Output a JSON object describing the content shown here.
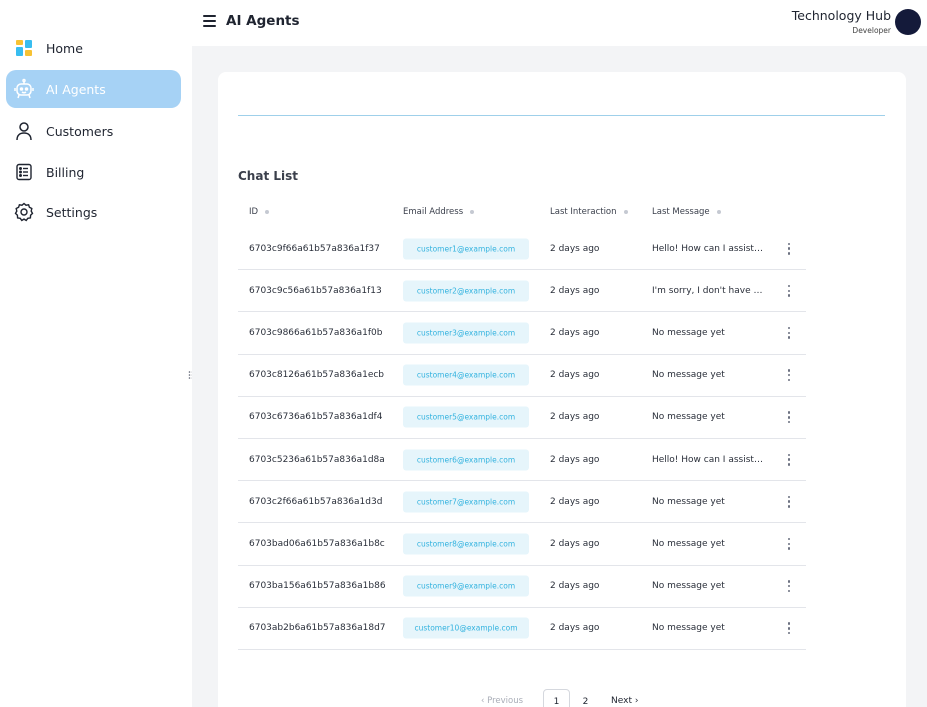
{
  "header": {
    "title": "AI Agents",
    "org_name": "Technology Hub",
    "org_role": "Developer"
  },
  "sidebar": {
    "items": [
      {
        "label": "Home",
        "icon": "home-icon"
      },
      {
        "label": "AI Agents",
        "icon": "robot-icon",
        "active": true
      },
      {
        "label": "Customers",
        "icon": "user-icon"
      },
      {
        "label": "Billing",
        "icon": "billing-icon"
      },
      {
        "label": "Settings",
        "icon": "gear-icon"
      }
    ]
  },
  "main": {
    "section_title": "Chat List",
    "columns": [
      "ID",
      "Email Address",
      "Last Interaction",
      "Last Message"
    ],
    "rows": [
      {
        "id": "6703c9f66a61b57a836a1f37",
        "email": "customer1@example.com",
        "last_interaction": "2 days ago",
        "last_message": "Hello! How can I assist ..."
      },
      {
        "id": "6703c9c56a61b57a836a1f13",
        "email": "customer2@example.com",
        "last_interaction": "2 days ago",
        "last_message": "I'm sorry, I don't have t..."
      },
      {
        "id": "6703c9866a61b57a836a1f0b",
        "email": "customer3@example.com",
        "last_interaction": "2 days ago",
        "last_message": "No message yet"
      },
      {
        "id": "6703c8126a61b57a836a1ecb",
        "email": "customer4@example.com",
        "last_interaction": "2 days ago",
        "last_message": "No message yet"
      },
      {
        "id": "6703c6736a61b57a836a1df4",
        "email": "customer5@example.com",
        "last_interaction": "2 days ago",
        "last_message": "No message yet"
      },
      {
        "id": "6703c5236a61b57a836a1d8a",
        "email": "customer6@example.com",
        "last_interaction": "2 days ago",
        "last_message": "Hello! How can I assist ..."
      },
      {
        "id": "6703c2f66a61b57a836a1d3d",
        "email": "customer7@example.com",
        "last_interaction": "2 days ago",
        "last_message": "No message yet"
      },
      {
        "id": "6703bad06a61b57a836a1b8c",
        "email": "customer8@example.com",
        "last_interaction": "2 days ago",
        "last_message": "No message yet"
      },
      {
        "id": "6703ba156a61b57a836a1b86",
        "email": "customer9@example.com",
        "last_interaction": "2 days ago",
        "last_message": "No message yet"
      },
      {
        "id": "6703ab2b6a61b57a836a18d7",
        "email": "customer10@example.com",
        "last_interaction": "2 days ago",
        "last_message": "No message yet"
      }
    ]
  },
  "pagination": {
    "previous_label": "‹ Previous",
    "pages": [
      "1",
      "2"
    ],
    "current_page": "1",
    "next_label": "Next ›"
  },
  "colors": {
    "accent": "#a6d2f5",
    "email_text": "#34b3df",
    "email_bg": "#e6f5fb",
    "avatar": "#141a3a"
  }
}
